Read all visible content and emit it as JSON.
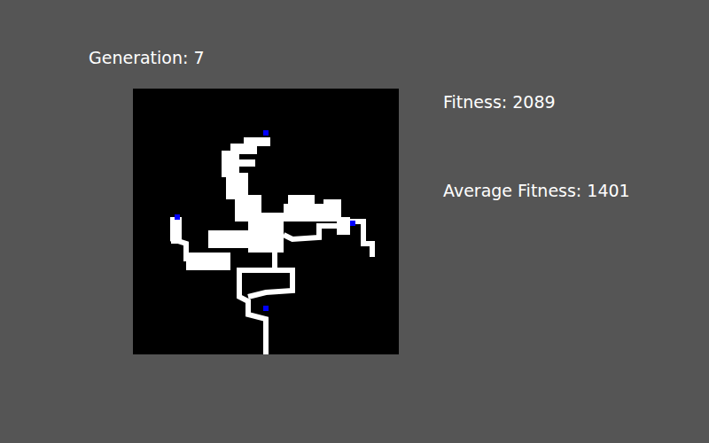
{
  "generation": {
    "label": "Generation: 7"
  },
  "stats": [
    {
      "label": "Fitness: 2089"
    },
    {
      "label": "Average Fitness: 1401"
    }
  ]
}
